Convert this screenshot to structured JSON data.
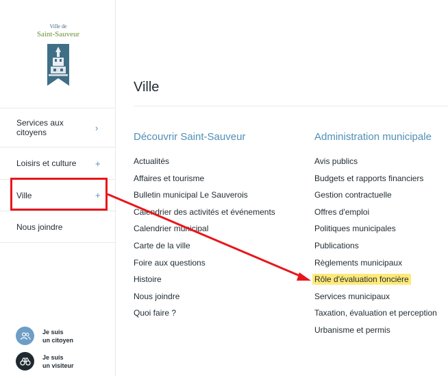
{
  "logo": {
    "line1": "Ville de",
    "line2": "Saint-Sauveur"
  },
  "sidebar": {
    "items": [
      {
        "label": "Services aux citoyens",
        "sign": "›"
      },
      {
        "label": "Loisirs et culture",
        "sign": "+"
      },
      {
        "label": "Ville",
        "sign": "+"
      },
      {
        "label": "Nous joindre",
        "sign": ""
      }
    ]
  },
  "personas": [
    {
      "line1": "Je suis",
      "line2": "un citoyen",
      "icon": "people-icon",
      "color": "#6e9dc6"
    },
    {
      "line1": "Je suis",
      "line2": "un visiteur",
      "icon": "binoculars-icon",
      "color": "#1f2a30"
    }
  ],
  "main": {
    "title": "Ville",
    "columns": [
      {
        "heading": "Découvrir Saint-Sauveur",
        "links": [
          "Actualités",
          "Affaires et tourisme",
          "Bulletin municipal Le Sauverois",
          "Calendrier des activités et événements",
          "Calendrier municipal",
          "Carte de la ville",
          "Foire aux questions",
          "Histoire",
          "Nous joindre",
          "Quoi faire ?"
        ]
      },
      {
        "heading": "Administration municipale",
        "links": [
          "Avis publics",
          "Budgets et rapports financiers",
          "Gestion contractuelle",
          "Offres d'emploi",
          "Politiques municipales",
          "Publications",
          "Règlements municipaux",
          "Rôle d'évaluation foncière",
          "Services municipaux",
          "Taxation, évaluation et perception",
          "Urbanisme et permis"
        ]
      }
    ]
  },
  "annotation_color": "#e8161b",
  "highlight_color": "#ffe97a"
}
